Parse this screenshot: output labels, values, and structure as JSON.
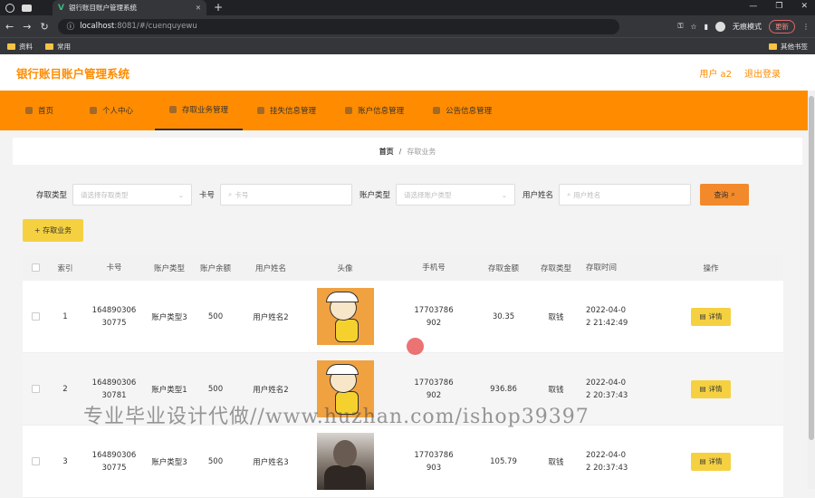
{
  "browser": {
    "tab_title": "银行账目账户管理系统",
    "url_host": "localhost",
    "url_rest": ":8081/#/cuenquyewu",
    "incognito_label": "无痕模式",
    "update_label": "更新",
    "bookmarks": [
      "资料",
      "常用"
    ],
    "bookmarks_other": "其他书签"
  },
  "header": {
    "title": "银行账目账户管理系统",
    "user": "用户 a2",
    "logout": "退出登录"
  },
  "nav": {
    "items": [
      {
        "label": "首页"
      },
      {
        "label": "个人中心"
      },
      {
        "label": "存取业务管理"
      },
      {
        "label": "挂失信息管理"
      },
      {
        "label": "账户信息管理"
      },
      {
        "label": "公告信息管理"
      }
    ]
  },
  "breadcrumb": {
    "home": "首页",
    "sep": "/",
    "current": "存取业务"
  },
  "search": {
    "type_label": "存取类型",
    "type_placeholder": "请选择存取类型",
    "card_label": "卡号",
    "card_placeholder": "卡号",
    "acct_type_label": "账户类型",
    "acct_type_placeholder": "请选择账户类型",
    "name_label": "用户姓名",
    "name_placeholder": "用户姓名",
    "query_label": "查询"
  },
  "add_button": "+ 存取业务",
  "table": {
    "columns": [
      "索引",
      "卡号",
      "账户类型",
      "账户余额",
      "用户姓名",
      "头像",
      "手机号",
      "存取金额",
      "存取类型",
      "存取时间",
      "操作"
    ],
    "rows": [
      {
        "index": "1",
        "card1": "164890306",
        "card2": "30775",
        "acct_type": "账户类型3",
        "balance": "500",
        "name": "用户姓名2",
        "phone1": "17703786",
        "phone2": "902",
        "amount": "30.35",
        "kind": "取钱",
        "time1": "2022-04-0",
        "time2": "2 21:42:49",
        "op": "详情"
      },
      {
        "index": "2",
        "card1": "164890306",
        "card2": "30781",
        "acct_type": "账户类型1",
        "balance": "500",
        "name": "用户姓名2",
        "phone1": "17703786",
        "phone2": "902",
        "amount": "936.86",
        "kind": "取钱",
        "time1": "2022-04-0",
        "time2": "2 20:37:43",
        "op": "详情"
      },
      {
        "index": "3",
        "card1": "164890306",
        "card2": "30775",
        "acct_type": "账户类型3",
        "balance": "500",
        "name": "用户姓名3",
        "phone1": "17703786",
        "phone2": "903",
        "amount": "105.79",
        "kind": "取钱",
        "time1": "2022-04-0",
        "time2": "2 20:37:43",
        "op": "详情"
      }
    ]
  },
  "watermark": "专业毕业设计代做//www.huzhan.com/ishop39397"
}
